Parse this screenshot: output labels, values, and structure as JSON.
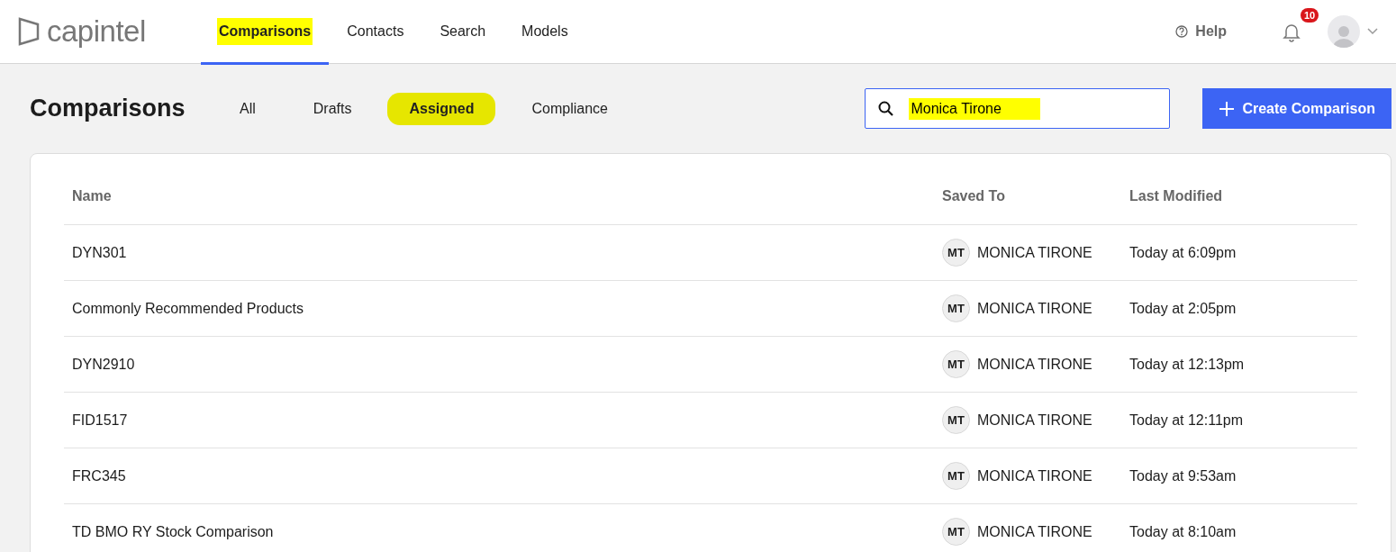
{
  "brand": "capintel",
  "nav": [
    {
      "label": "Comparisons",
      "selected": true,
      "highlighted": true
    },
    {
      "label": "Contacts",
      "selected": false,
      "highlighted": false
    },
    {
      "label": "Search",
      "selected": false,
      "highlighted": false
    },
    {
      "label": "Models",
      "selected": false,
      "highlighted": false
    }
  ],
  "help": "Help",
  "notifications": {
    "count": "10"
  },
  "page_title": "Comparisons",
  "tabs": [
    {
      "label": "All",
      "selected": false,
      "highlighted": false
    },
    {
      "label": "Drafts",
      "selected": false,
      "highlighted": false
    },
    {
      "label": "Assigned",
      "selected": true,
      "highlighted": true
    },
    {
      "label": "Compliance",
      "selected": false,
      "highlighted": false
    }
  ],
  "search": {
    "value": "Monica Tirone",
    "highlighted": true
  },
  "create_button": "Create Comparison",
  "table": {
    "columns": [
      "Name",
      "Saved To",
      "Last Modified"
    ],
    "rows": [
      {
        "name": "DYN301",
        "initials": "MT",
        "saved_to": "MONICA TIRONE",
        "modified": "Today at 6:09pm"
      },
      {
        "name": "Commonly Recommended Products",
        "initials": "MT",
        "saved_to": "MONICA TIRONE",
        "modified": "Today at 2:05pm"
      },
      {
        "name": "DYN2910",
        "initials": "MT",
        "saved_to": "MONICA TIRONE",
        "modified": "Today at 12:13pm"
      },
      {
        "name": "FID1517",
        "initials": "MT",
        "saved_to": "MONICA TIRONE",
        "modified": "Today at 12:11pm"
      },
      {
        "name": "FRC345",
        "initials": "MT",
        "saved_to": "MONICA TIRONE",
        "modified": "Today at 9:53am"
      },
      {
        "name": "TD BMO RY Stock Comparison",
        "initials": "MT",
        "saved_to": "MONICA TIRONE",
        "modified": "Today at 8:10am"
      }
    ]
  }
}
